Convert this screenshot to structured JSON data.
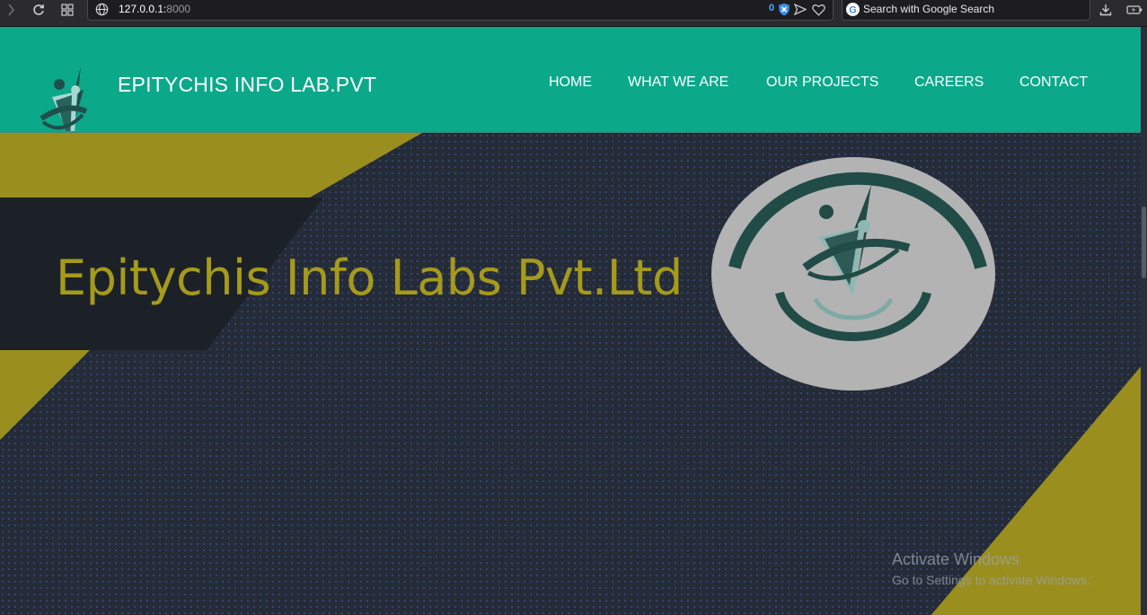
{
  "browser": {
    "url_host": "127.0.0.1:",
    "url_port": "8000",
    "blocked_count": "0",
    "search_placeholder": "Search with Google Search",
    "icons": [
      "back-icon",
      "reload-icon",
      "tabs-grid-icon",
      "globe-icon",
      "shield-x-icon",
      "send-icon",
      "heart-icon",
      "google-icon",
      "download-icon",
      "battery-icon"
    ]
  },
  "navbar": {
    "brand": "EPITYCHIS INFO LAB.PVT",
    "links": [
      "HOME",
      "WHAT WE ARE",
      "OUR PROJECTS",
      "CAREERS",
      "CONTACT"
    ],
    "background": "#0ba98a"
  },
  "hero": {
    "title": "Epitychis Info Labs Pvt.Ltd",
    "accent": "#a59a1c",
    "background": "#232a36"
  },
  "watermark": {
    "line1": "Activate Windows",
    "line2": "Go to Settings to activate Windows."
  }
}
